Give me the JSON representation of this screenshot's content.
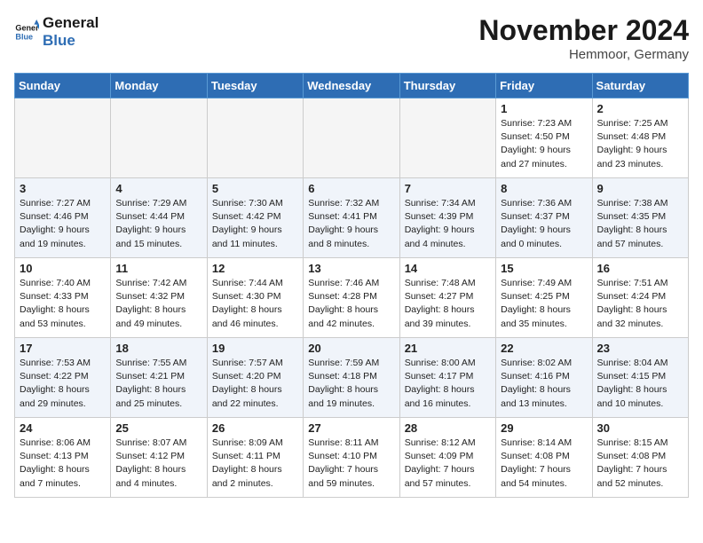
{
  "logo": {
    "line1": "General",
    "line2": "Blue"
  },
  "title": "November 2024",
  "subtitle": "Hemmoor, Germany",
  "weekdays": [
    "Sunday",
    "Monday",
    "Tuesday",
    "Wednesday",
    "Thursday",
    "Friday",
    "Saturday"
  ],
  "weeks": [
    [
      {
        "day": "",
        "detail": ""
      },
      {
        "day": "",
        "detail": ""
      },
      {
        "day": "",
        "detail": ""
      },
      {
        "day": "",
        "detail": ""
      },
      {
        "day": "",
        "detail": ""
      },
      {
        "day": "1",
        "detail": "Sunrise: 7:23 AM\nSunset: 4:50 PM\nDaylight: 9 hours\nand 27 minutes."
      },
      {
        "day": "2",
        "detail": "Sunrise: 7:25 AM\nSunset: 4:48 PM\nDaylight: 9 hours\nand 23 minutes."
      }
    ],
    [
      {
        "day": "3",
        "detail": "Sunrise: 7:27 AM\nSunset: 4:46 PM\nDaylight: 9 hours\nand 19 minutes."
      },
      {
        "day": "4",
        "detail": "Sunrise: 7:29 AM\nSunset: 4:44 PM\nDaylight: 9 hours\nand 15 minutes."
      },
      {
        "day": "5",
        "detail": "Sunrise: 7:30 AM\nSunset: 4:42 PM\nDaylight: 9 hours\nand 11 minutes."
      },
      {
        "day": "6",
        "detail": "Sunrise: 7:32 AM\nSunset: 4:41 PM\nDaylight: 9 hours\nand 8 minutes."
      },
      {
        "day": "7",
        "detail": "Sunrise: 7:34 AM\nSunset: 4:39 PM\nDaylight: 9 hours\nand 4 minutes."
      },
      {
        "day": "8",
        "detail": "Sunrise: 7:36 AM\nSunset: 4:37 PM\nDaylight: 9 hours\nand 0 minutes."
      },
      {
        "day": "9",
        "detail": "Sunrise: 7:38 AM\nSunset: 4:35 PM\nDaylight: 8 hours\nand 57 minutes."
      }
    ],
    [
      {
        "day": "10",
        "detail": "Sunrise: 7:40 AM\nSunset: 4:33 PM\nDaylight: 8 hours\nand 53 minutes."
      },
      {
        "day": "11",
        "detail": "Sunrise: 7:42 AM\nSunset: 4:32 PM\nDaylight: 8 hours\nand 49 minutes."
      },
      {
        "day": "12",
        "detail": "Sunrise: 7:44 AM\nSunset: 4:30 PM\nDaylight: 8 hours\nand 46 minutes."
      },
      {
        "day": "13",
        "detail": "Sunrise: 7:46 AM\nSunset: 4:28 PM\nDaylight: 8 hours\nand 42 minutes."
      },
      {
        "day": "14",
        "detail": "Sunrise: 7:48 AM\nSunset: 4:27 PM\nDaylight: 8 hours\nand 39 minutes."
      },
      {
        "day": "15",
        "detail": "Sunrise: 7:49 AM\nSunset: 4:25 PM\nDaylight: 8 hours\nand 35 minutes."
      },
      {
        "day": "16",
        "detail": "Sunrise: 7:51 AM\nSunset: 4:24 PM\nDaylight: 8 hours\nand 32 minutes."
      }
    ],
    [
      {
        "day": "17",
        "detail": "Sunrise: 7:53 AM\nSunset: 4:22 PM\nDaylight: 8 hours\nand 29 minutes."
      },
      {
        "day": "18",
        "detail": "Sunrise: 7:55 AM\nSunset: 4:21 PM\nDaylight: 8 hours\nand 25 minutes."
      },
      {
        "day": "19",
        "detail": "Sunrise: 7:57 AM\nSunset: 4:20 PM\nDaylight: 8 hours\nand 22 minutes."
      },
      {
        "day": "20",
        "detail": "Sunrise: 7:59 AM\nSunset: 4:18 PM\nDaylight: 8 hours\nand 19 minutes."
      },
      {
        "day": "21",
        "detail": "Sunrise: 8:00 AM\nSunset: 4:17 PM\nDaylight: 8 hours\nand 16 minutes."
      },
      {
        "day": "22",
        "detail": "Sunrise: 8:02 AM\nSunset: 4:16 PM\nDaylight: 8 hours\nand 13 minutes."
      },
      {
        "day": "23",
        "detail": "Sunrise: 8:04 AM\nSunset: 4:15 PM\nDaylight: 8 hours\nand 10 minutes."
      }
    ],
    [
      {
        "day": "24",
        "detail": "Sunrise: 8:06 AM\nSunset: 4:13 PM\nDaylight: 8 hours\nand 7 minutes."
      },
      {
        "day": "25",
        "detail": "Sunrise: 8:07 AM\nSunset: 4:12 PM\nDaylight: 8 hours\nand 4 minutes."
      },
      {
        "day": "26",
        "detail": "Sunrise: 8:09 AM\nSunset: 4:11 PM\nDaylight: 8 hours\nand 2 minutes."
      },
      {
        "day": "27",
        "detail": "Sunrise: 8:11 AM\nSunset: 4:10 PM\nDaylight: 7 hours\nand 59 minutes."
      },
      {
        "day": "28",
        "detail": "Sunrise: 8:12 AM\nSunset: 4:09 PM\nDaylight: 7 hours\nand 57 minutes."
      },
      {
        "day": "29",
        "detail": "Sunrise: 8:14 AM\nSunset: 4:08 PM\nDaylight: 7 hours\nand 54 minutes."
      },
      {
        "day": "30",
        "detail": "Sunrise: 8:15 AM\nSunset: 4:08 PM\nDaylight: 7 hours\nand 52 minutes."
      }
    ]
  ]
}
